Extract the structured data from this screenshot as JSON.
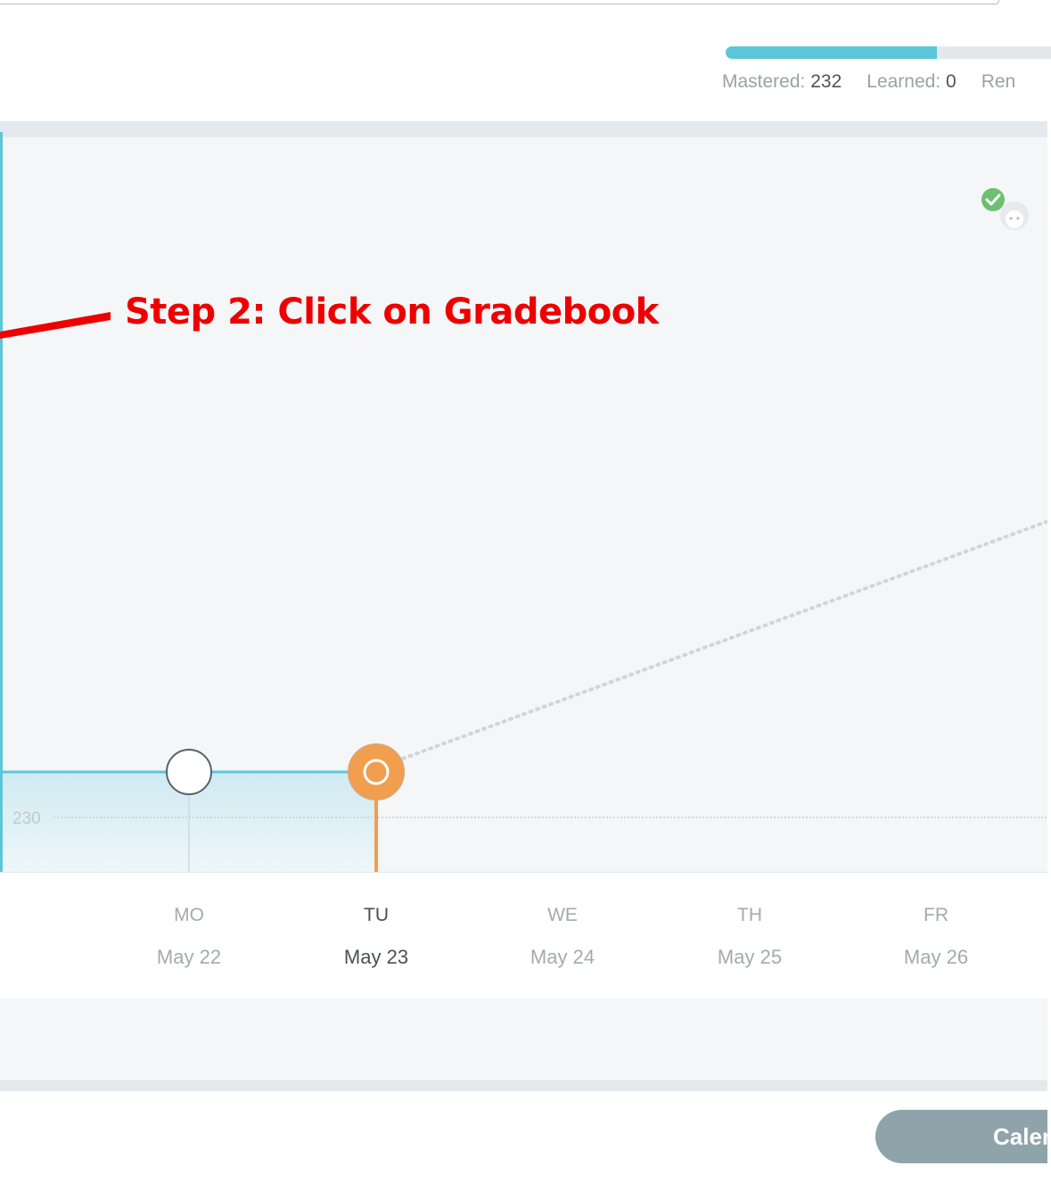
{
  "header": {
    "mastered_label": "Mastered:",
    "mastered_value": "232",
    "learned_label": "Learned:",
    "learned_value": "0",
    "remaining_label": "Ren"
  },
  "progress": {
    "filled_fraction": 0.65,
    "fill_color": "#5cc6d8",
    "track_color": "#e3e8ec"
  },
  "annotation": {
    "text": "Step 2: Click on Gradebook",
    "color": "#ef0000"
  },
  "graph": {
    "y_tick_label": "230",
    "completed_color": "#5cc6d8",
    "today_color": "#f19e4e",
    "icons": [
      "check-icon",
      "avatar-icon"
    ]
  },
  "days": [
    {
      "abbr": "MO",
      "date": "May 22",
      "active": false
    },
    {
      "abbr": "TU",
      "date": "May 23",
      "active": true
    },
    {
      "abbr": "WE",
      "date": "May 24",
      "active": false
    },
    {
      "abbr": "TH",
      "date": "May 25",
      "active": false
    },
    {
      "abbr": "FR",
      "date": "May 26",
      "active": false
    }
  ],
  "footer": {
    "calendar_button_label": "Calendar"
  }
}
